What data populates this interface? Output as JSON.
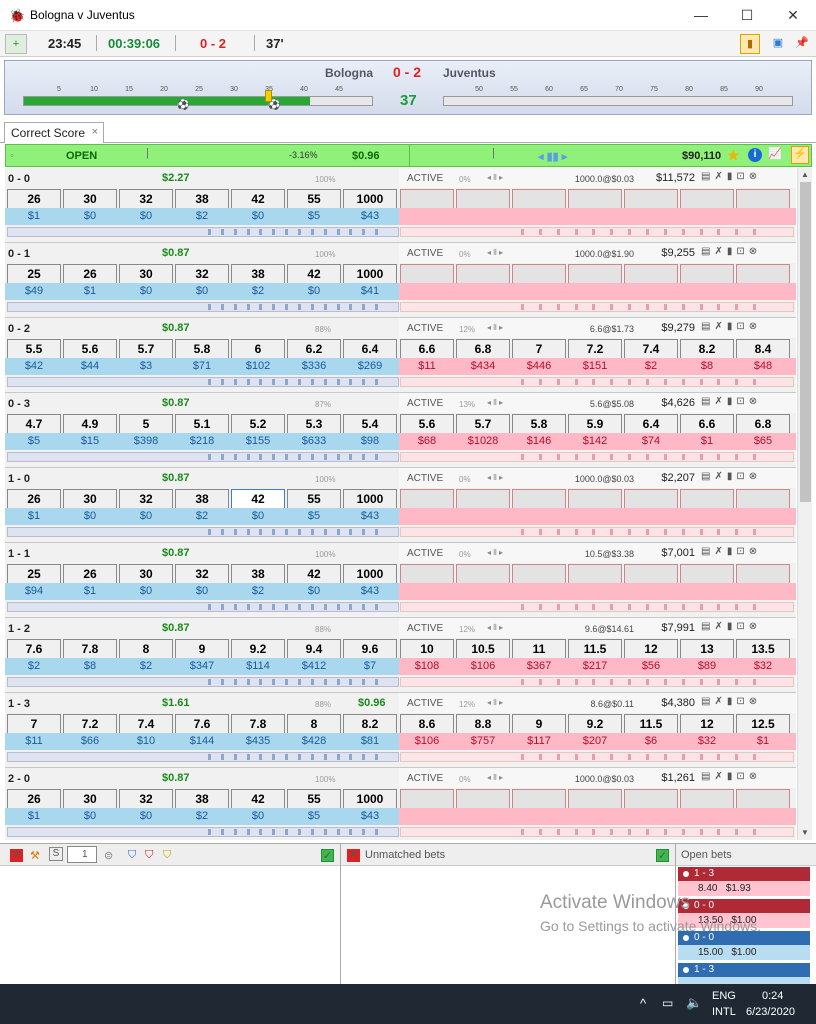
{
  "window": {
    "title": "Bologna v Juventus",
    "minimize": "—",
    "maximize": "☐",
    "close": "✕"
  },
  "toolbar": {
    "clock": "23:45",
    "elapsed": "00:39:06",
    "score": "0 - 2",
    "minute": "37'"
  },
  "scoreboard": {
    "home": "Bologna",
    "score": "0 - 2",
    "away": "Juventus",
    "minute": "37",
    "first_half_ticks": [
      "5",
      "10",
      "15",
      "20",
      "25",
      "30",
      "35",
      "40",
      "45"
    ],
    "second_half_ticks": [
      "50",
      "55",
      "60",
      "65",
      "70",
      "75",
      "80",
      "85",
      "90"
    ],
    "first_half_progress": 0.822
  },
  "tab": {
    "label": "Correct Score",
    "close": "×"
  },
  "market": {
    "status": "OPEN",
    "pl_pct": "-3.16%",
    "pl": "$0.96",
    "matched": "$90,110"
  },
  "selections": [
    {
      "name": "0 - 0",
      "pl": "$2.27",
      "pct": "100%",
      "pl2": "",
      "state": "ACTIVE",
      "rpct": "0%",
      "last": "1000.0@$0.03",
      "matched": "$11,572",
      "back": [
        "26",
        "30",
        "32",
        "38",
        "42",
        "55",
        "1000"
      ],
      "back_amt": [
        "$1",
        "$0",
        "$0",
        "$2",
        "$0",
        "$5",
        "$43"
      ],
      "lay": [
        "",
        "",
        "",
        "",
        "",
        "",
        ""
      ],
      "lay_amt": [
        "",
        "",
        "",
        "",
        "",
        "",
        ""
      ]
    },
    {
      "name": "0 - 1",
      "pl": "$0.87",
      "pct": "100%",
      "pl2": "",
      "state": "ACTIVE",
      "rpct": "0%",
      "last": "1000.0@$1.90",
      "matched": "$9,255",
      "back": [
        "25",
        "26",
        "30",
        "32",
        "38",
        "42",
        "1000"
      ],
      "back_amt": [
        "$49",
        "$1",
        "$0",
        "$0",
        "$2",
        "$0",
        "$41"
      ],
      "lay": [
        "",
        "",
        "",
        "",
        "",
        "",
        ""
      ],
      "lay_amt": [
        "",
        "",
        "",
        "",
        "",
        "",
        ""
      ]
    },
    {
      "name": "0 - 2",
      "pl": "$0.87",
      "pct": "88%",
      "pl2": "",
      "state": "ACTIVE",
      "rpct": "12%",
      "last": "6.6@$1.73",
      "matched": "$9,279",
      "back": [
        "5.5",
        "5.6",
        "5.7",
        "5.8",
        "6",
        "6.2",
        "6.4"
      ],
      "back_amt": [
        "$42",
        "$44",
        "$3",
        "$71",
        "$102",
        "$336",
        "$269"
      ],
      "lay": [
        "6.6",
        "6.8",
        "7",
        "7.2",
        "7.4",
        "8.2",
        "8.4"
      ],
      "lay_amt": [
        "$11",
        "$434",
        "$446",
        "$151",
        "$2",
        "$8",
        "$48"
      ]
    },
    {
      "name": "0 - 3",
      "pl": "$0.87",
      "pct": "87%",
      "pl2": "",
      "state": "ACTIVE",
      "rpct": "13%",
      "last": "5.6@$5.08",
      "matched": "$4,626",
      "back": [
        "4.7",
        "4.9",
        "5",
        "5.1",
        "5.2",
        "5.3",
        "5.4"
      ],
      "back_amt": [
        "$5",
        "$15",
        "$398",
        "$218",
        "$155",
        "$633",
        "$98"
      ],
      "lay": [
        "5.6",
        "5.7",
        "5.8",
        "5.9",
        "6.4",
        "6.6",
        "6.8"
      ],
      "lay_amt": [
        "$68",
        "$1028",
        "$146",
        "$142",
        "$74",
        "$1",
        "$65"
      ]
    },
    {
      "name": "1 - 0",
      "pl": "$0.87",
      "pct": "100%",
      "pl2": "",
      "state": "ACTIVE",
      "rpct": "0%",
      "last": "1000.0@$0.03",
      "matched": "$2,207",
      "back": [
        "26",
        "30",
        "32",
        "38",
        "42",
        "55",
        "1000"
      ],
      "back_amt": [
        "$1",
        "$0",
        "$0",
        "$2",
        "$0",
        "$5",
        "$43"
      ],
      "lay": [
        "",
        "",
        "",
        "",
        "",
        "",
        ""
      ],
      "lay_amt": [
        "",
        "",
        "",
        "",
        "",
        "",
        ""
      ]
    },
    {
      "name": "1 - 1",
      "pl": "$0.87",
      "pct": "100%",
      "pl2": "",
      "state": "ACTIVE",
      "rpct": "0%",
      "last": "10.5@$3.38",
      "matched": "$7,001",
      "back": [
        "25",
        "26",
        "30",
        "32",
        "38",
        "42",
        "1000"
      ],
      "back_amt": [
        "$94",
        "$1",
        "$0",
        "$0",
        "$2",
        "$0",
        "$43"
      ],
      "lay": [
        "",
        "",
        "",
        "",
        "",
        "",
        ""
      ],
      "lay_amt": [
        "",
        "",
        "",
        "",
        "",
        "",
        ""
      ]
    },
    {
      "name": "1 - 2",
      "pl": "$0.87",
      "pct": "88%",
      "pl2": "",
      "state": "ACTIVE",
      "rpct": "12%",
      "last": "9.6@$14.61",
      "matched": "$7,991",
      "back": [
        "7.6",
        "7.8",
        "8",
        "9",
        "9.2",
        "9.4",
        "9.6"
      ],
      "back_amt": [
        "$2",
        "$8",
        "$2",
        "$347",
        "$114",
        "$412",
        "$7"
      ],
      "lay": [
        "10",
        "10.5",
        "11",
        "11.5",
        "12",
        "13",
        "13.5"
      ],
      "lay_amt": [
        "$108",
        "$106",
        "$367",
        "$217",
        "$56",
        "$89",
        "$32"
      ]
    },
    {
      "name": "1 - 3",
      "pl": "$1.61",
      "pct": "88%",
      "pl2": "$0.96",
      "state": "ACTIVE",
      "rpct": "12%",
      "last": "8.6@$0.11",
      "matched": "$4,380",
      "back": [
        "7",
        "7.2",
        "7.4",
        "7.6",
        "7.8",
        "8",
        "8.2"
      ],
      "back_amt": [
        "$11",
        "$66",
        "$10",
        "$144",
        "$435",
        "$428",
        "$81"
      ],
      "lay": [
        "8.6",
        "8.8",
        "9",
        "9.2",
        "11.5",
        "12",
        "12.5"
      ],
      "lay_amt": [
        "$106",
        "$757",
        "$117",
        "$207",
        "$6",
        "$32",
        "$1"
      ]
    },
    {
      "name": "2 - 0",
      "pl": "$0.87",
      "pct": "100%",
      "pl2": "",
      "state": "ACTIVE",
      "rpct": "0%",
      "last": "1000.0@$0.03",
      "matched": "$1,261",
      "back": [
        "26",
        "30",
        "32",
        "38",
        "42",
        "55",
        "1000"
      ],
      "back_amt": [
        "$1",
        "$0",
        "$0",
        "$2",
        "$0",
        "$5",
        "$43"
      ],
      "lay": [
        "",
        "",
        "",
        "",
        "",
        "",
        ""
      ],
      "lay_amt": [
        "",
        "",
        "",
        "",
        "",
        "",
        ""
      ]
    }
  ],
  "bottom": {
    "stake_value": "1",
    "unmatched_label": "Unmatched bets",
    "open_label": "Open bets",
    "open_bets": [
      {
        "name": "1 - 3",
        "odds": "8.40",
        "stake": "$1.93",
        "type": "lay"
      },
      {
        "name": "0 - 0",
        "odds": "13.50",
        "stake": "$1.00",
        "type": "lay"
      },
      {
        "name": "0 - 0",
        "odds": "15.00",
        "stake": "$1.00",
        "type": "back"
      },
      {
        "name": "1 - 3",
        "odds": "",
        "stake": "",
        "type": "back"
      }
    ]
  },
  "watermark": {
    "line1": "Activate Windows",
    "line2": "Go to Settings to activate Windows."
  },
  "taskbar": {
    "lang": "ENG",
    "layout": "INTL",
    "time": "0:24",
    "date": "6/23/2020"
  },
  "colors": {
    "back": "#a9d8ee",
    "lay": "#ffb8c6",
    "open_bar": "#8ff07a",
    "timeline": "#27a833"
  }
}
